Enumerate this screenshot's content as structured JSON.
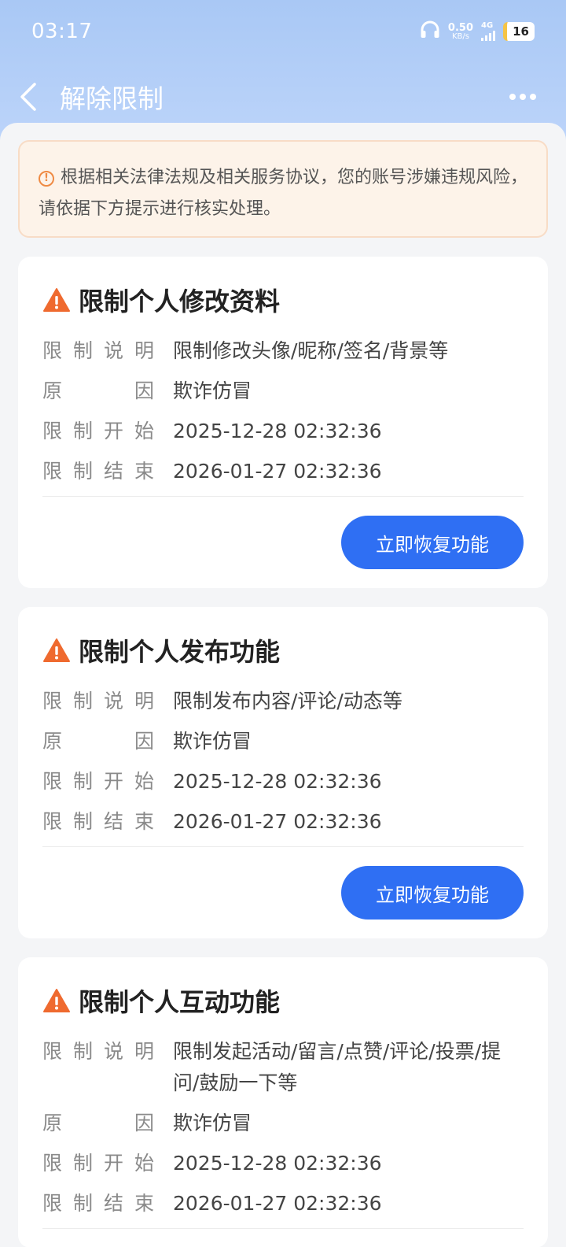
{
  "status_bar": {
    "time": "03:17",
    "speed_value": "0.50",
    "speed_unit": "KB/s",
    "network": "4G",
    "battery": "16"
  },
  "header": {
    "title": "解除限制"
  },
  "notice": {
    "text": "根据相关法律法规及相关服务协议，您的账号涉嫌违规风险，请依据下方提示进行核实处理。"
  },
  "labels": {
    "description": [
      "限",
      "制",
      "说",
      "明"
    ],
    "reason": [
      "原",
      "因"
    ],
    "start": [
      "限",
      "制",
      "开",
      "始"
    ],
    "end": [
      "限",
      "制",
      "结",
      "束"
    ]
  },
  "cards": [
    {
      "title": "限制个人修改资料",
      "description": "限制修改头像/昵称/签名/背景等",
      "reason": "欺诈仿冒",
      "start": "2025-12-28 02:32:36",
      "end": "2026-01-27 02:32:36",
      "button": "立即恢复功能"
    },
    {
      "title": "限制个人发布功能",
      "description": "限制发布内容/评论/动态等",
      "reason": "欺诈仿冒",
      "start": "2025-12-28 02:32:36",
      "end": "2026-01-27 02:32:36",
      "button": "立即恢复功能"
    },
    {
      "title": "限制个人互动功能",
      "description": "限制发起活动/留言/点赞/评论/投票/提问/鼓励一下等",
      "reason": "欺诈仿冒",
      "start": "2025-12-28 02:32:36",
      "end": "2026-01-27 02:32:36"
    }
  ],
  "icons": {
    "back": "chevron-left-icon",
    "more": "more-dots-icon",
    "info": "info-icon",
    "warning": "warning-triangle-icon",
    "headphones": "headphones-icon",
    "signal": "signal-icon"
  },
  "colors": {
    "accent": "#2f6ff3",
    "warning": "#ef6a2f",
    "header": "#a9c8f5"
  }
}
